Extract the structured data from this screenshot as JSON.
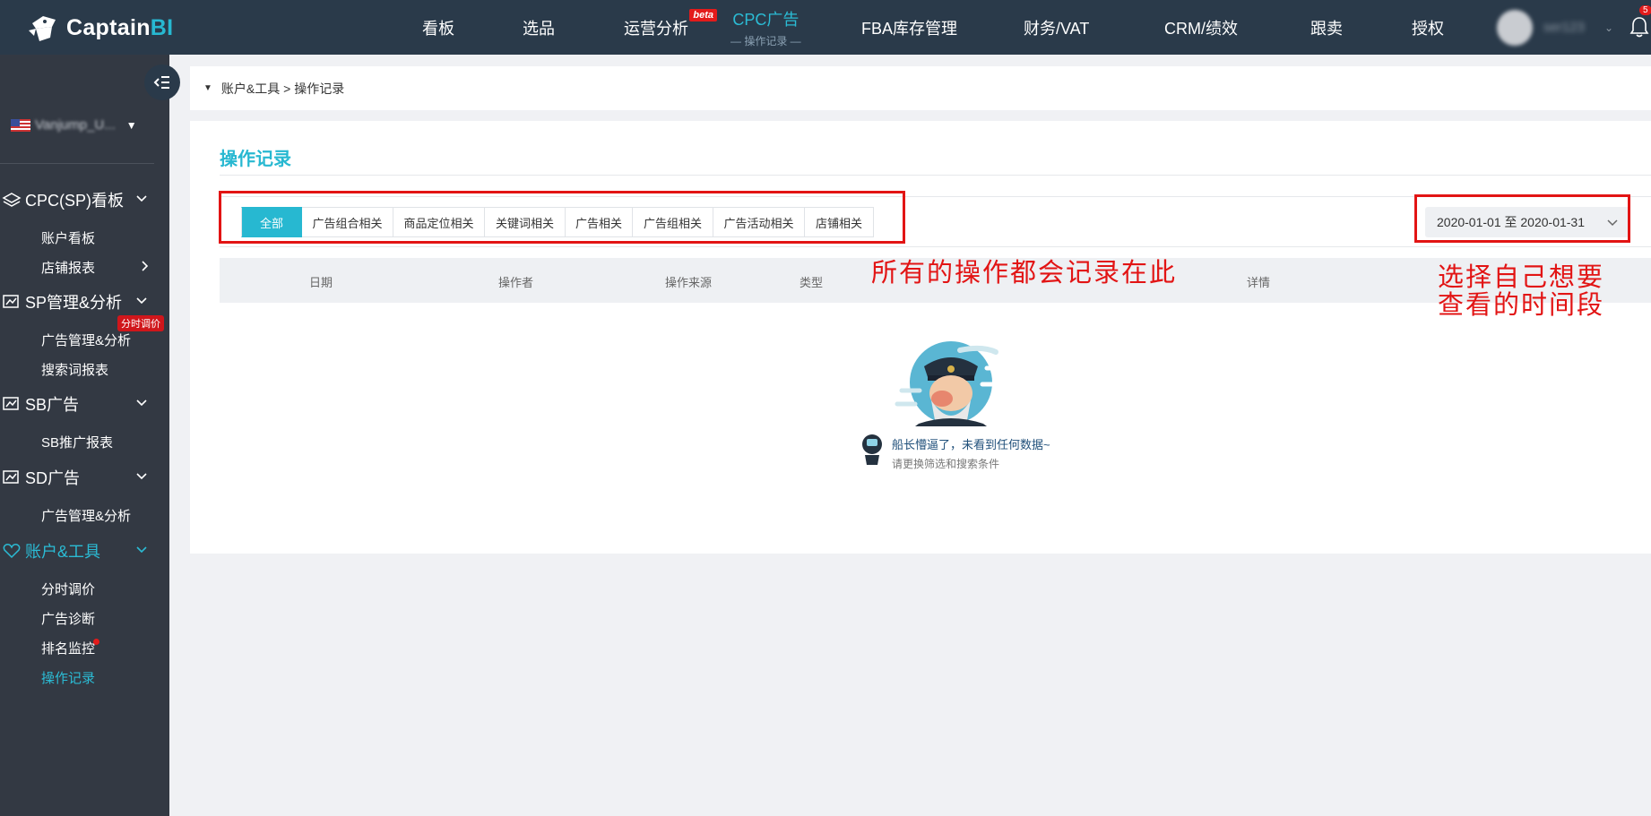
{
  "header": {
    "logo_text": "Captain",
    "logo_bi": "BI",
    "nav": [
      {
        "label": "看板"
      },
      {
        "label": "选品"
      },
      {
        "label": "运营分析",
        "badge": "beta"
      },
      {
        "label": "CPC广告",
        "sub": "— 操作记录 —",
        "active": true
      },
      {
        "label": "FBA库存管理"
      },
      {
        "label": "财务/VAT"
      },
      {
        "label": "CRM/绩效"
      },
      {
        "label": "跟卖"
      },
      {
        "label": "授权"
      }
    ],
    "username": "ser123",
    "notification_count": "5"
  },
  "sidebar": {
    "store_name": "Vanjump_U...",
    "groups": [
      {
        "label": "CPC(SP)看板",
        "items": [
          "账户看板",
          "店铺报表"
        ]
      },
      {
        "label": "SP管理&分析",
        "tag": "分时调价",
        "items": [
          "广告管理&分析",
          "搜索词报表"
        ]
      },
      {
        "label": "SB广告",
        "items": [
          "SB推广报表"
        ]
      },
      {
        "label": "SD广告",
        "items": [
          "广告管理&分析"
        ]
      },
      {
        "label": "账户&工具",
        "items": [
          "分时调价",
          "广告诊断",
          "排名监控",
          "操作记录"
        ]
      }
    ]
  },
  "breadcrumb": "账户&工具 > 操作记录",
  "main": {
    "title": "操作记录",
    "tabs": [
      "全部",
      "广告组合相关",
      "商品定位相关",
      "关键词相关",
      "广告相关",
      "广告组相关",
      "广告活动相关",
      "店铺相关"
    ],
    "date_range": "2020-01-01 至 2020-01-31",
    "columns": [
      "日期",
      "操作者",
      "操作来源",
      "类型",
      "详情"
    ],
    "empty_message": "船长懵逼了，未看到任何数据~",
    "empty_hint": "请更换筛选和搜索条件"
  },
  "annotations": {
    "tabs_note": "所有的操作都会记录在此",
    "date_note_line1": "选择自己想要",
    "date_note_line2": "查看的时间段"
  },
  "colors": {
    "accent": "#27b8d1",
    "topbar": "#2a3a4a",
    "sidebar": "#333943",
    "annotation": "#e21414"
  }
}
